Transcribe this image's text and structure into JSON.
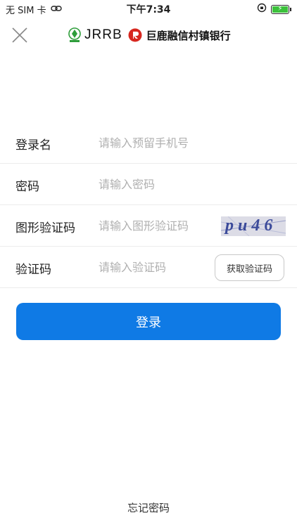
{
  "status_bar": {
    "carrier": "无 SIM 卡",
    "time": "下午7:34",
    "icons": [
      "link-icon",
      "orientation-lock-icon",
      "battery-charging-icon"
    ],
    "battery_color": "#3bc13b"
  },
  "nav": {
    "close_icon": "close-icon",
    "brand_abbr": "JRRB",
    "brand_name": "巨鹿融信村镇银行",
    "logo_a_color": "#2e9d3a",
    "logo_b_color": "#d7271f"
  },
  "form": {
    "login_name": {
      "label": "登录名",
      "placeholder": "请输入预留手机号",
      "value": ""
    },
    "password": {
      "label": "密码",
      "placeholder": "请输入密码",
      "value": ""
    },
    "captcha": {
      "label": "图形验证码",
      "placeholder": "请输入图形验证码",
      "value": "",
      "image_text": "pu46"
    },
    "sms_code": {
      "label": "验证码",
      "placeholder": "请输入验证码",
      "value": "",
      "button_label": "获取验证码"
    }
  },
  "login_button": {
    "label": "登录",
    "color": "#0f7ae5"
  },
  "forgot_password": "忘记密码"
}
